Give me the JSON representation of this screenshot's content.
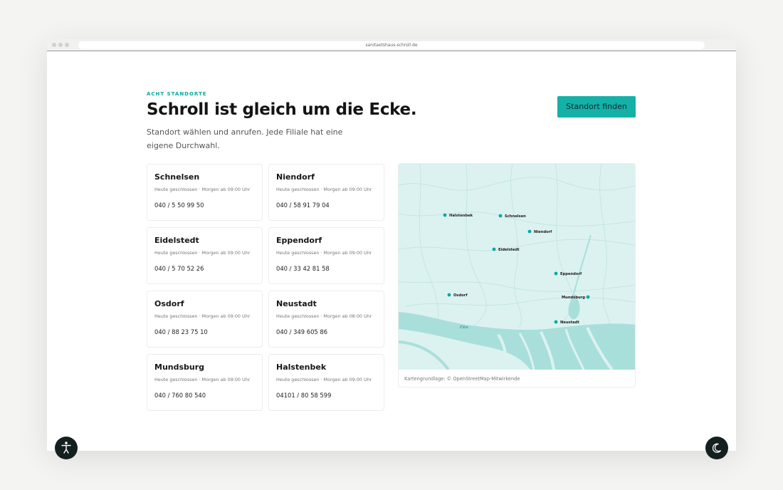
{
  "browser": {
    "url": "sanitaetshaus-schroll.de"
  },
  "header": {
    "eyebrow": "ACHT STANDORTE",
    "title": "Schroll ist gleich um die Ecke.",
    "subtitle": "Standort wählen und anrufen. Jede Filiale hat eine eigene Durchwahl.",
    "cta_label": "Standort finden"
  },
  "locations": [
    {
      "name": "Schnelsen",
      "hours": "Heute geschlossen · Morgen ab 09:00 Uhr",
      "phone": "040 / 5 50 99 50"
    },
    {
      "name": "Niendorf",
      "hours": "Heute geschlossen · Morgen ab 09:00 Uhr",
      "phone": "040 / 58 91 79 04"
    },
    {
      "name": "Eidelstedt",
      "hours": "Heute geschlossen · Morgen ab 09:00 Uhr",
      "phone": "040 / 5 70 52 26"
    },
    {
      "name": "Eppendorf",
      "hours": "Heute geschlossen · Morgen ab 09:00 Uhr",
      "phone": "040 / 33 42 81 58"
    },
    {
      "name": "Osdorf",
      "hours": "Heute geschlossen · Morgen ab 09:00 Uhr",
      "phone": "040 / 88 23 75 10"
    },
    {
      "name": "Neustadt",
      "hours": "Heute geschlossen · Morgen ab 08:00 Uhr",
      "phone": "040 / 349 605 86"
    },
    {
      "name": "Mundsburg",
      "hours": "Heute geschlossen · Morgen ab 09:00 Uhr",
      "phone": "040 / 760 80 540"
    },
    {
      "name": "Halstenbek",
      "hours": "Heute geschlossen · Morgen ab 09:00 Uhr",
      "phone": "04101 / 80 58 599"
    }
  ],
  "map": {
    "river_label": "Elbe",
    "caption": "Kartengrundlage: © OpenStreetMap-Mitwirkende",
    "markers": {
      "halstenbek": "Halstenbek",
      "schnelsen": "Schnelsen",
      "niendorf": "Niendorf",
      "eidelstedt": "Eidelstedt",
      "eppendorf": "Eppendorf",
      "osdorf": "Osdorf",
      "mundsburg": "Mundsburg",
      "neustadt": "Neustadt"
    }
  },
  "colors": {
    "accent": "#15b0a7",
    "map_water": "#a9dfdb",
    "map_land": "#dcf2f0"
  },
  "icons": {
    "accessibility": "accessibility-icon",
    "dark_mode": "moon-icon"
  }
}
